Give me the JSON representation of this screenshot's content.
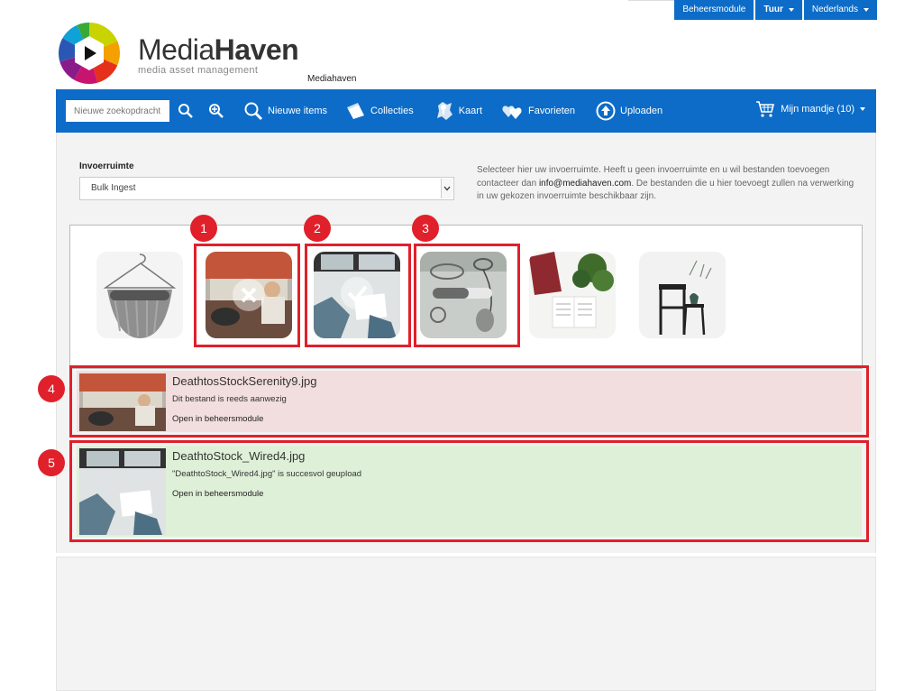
{
  "topbar": {
    "admin_label": "Beheersmodule",
    "user_label": "Tuur",
    "language_label": "Nederlands"
  },
  "logo": {
    "title_regular": "Media",
    "title_bold": "Haven",
    "subtitle": "media asset management"
  },
  "site_label": "Mediahaven",
  "nav": {
    "search_placeholder": "Nieuwe zoekopdracht",
    "items": [
      {
        "label": "Nieuwe items",
        "icon": "magnifier-icon"
      },
      {
        "label": "Collecties",
        "icon": "collections-icon"
      },
      {
        "label": "Kaart",
        "icon": "map-icon"
      },
      {
        "label": "Favorieten",
        "icon": "hearts-icon"
      },
      {
        "label": "Uploaden",
        "icon": "upload-icon"
      }
    ],
    "cart_label": "Mijn mandje (10)"
  },
  "upload": {
    "field_label": "Invoerruimte",
    "selected_space": "Bulk Ingest",
    "help_before": "Selecteer hier uw invoerruimte. Heeft u geen invoerruimte en u wil bestanden toevoegen contacteer dan ",
    "help_email": "info@mediahaven.com",
    "help_after": ". De bestanden die u hier toevoegt zullen na verwerking in uw gekozen invoerruimte beschikbaar zijn."
  },
  "callouts": [
    "1",
    "2",
    "3",
    "4",
    "5"
  ],
  "results": [
    {
      "filename": "DeathtosStockSerenity9.jpg",
      "message": "Dit bestand is reeds aanwezig",
      "link": "Open in beheersmodule",
      "status": "error"
    },
    {
      "filename": "DeathtoStock_Wired4.jpg",
      "message": "\"DeathtoStock_Wired4.jpg\" is succesvol geupload",
      "link": "Open in beheersmodule",
      "status": "success"
    }
  ],
  "colors": {
    "brand_blue": "#0d6cc7",
    "callout_red": "#e0202a",
    "error_bg": "#f2dede",
    "success_bg": "#dff0d8"
  }
}
